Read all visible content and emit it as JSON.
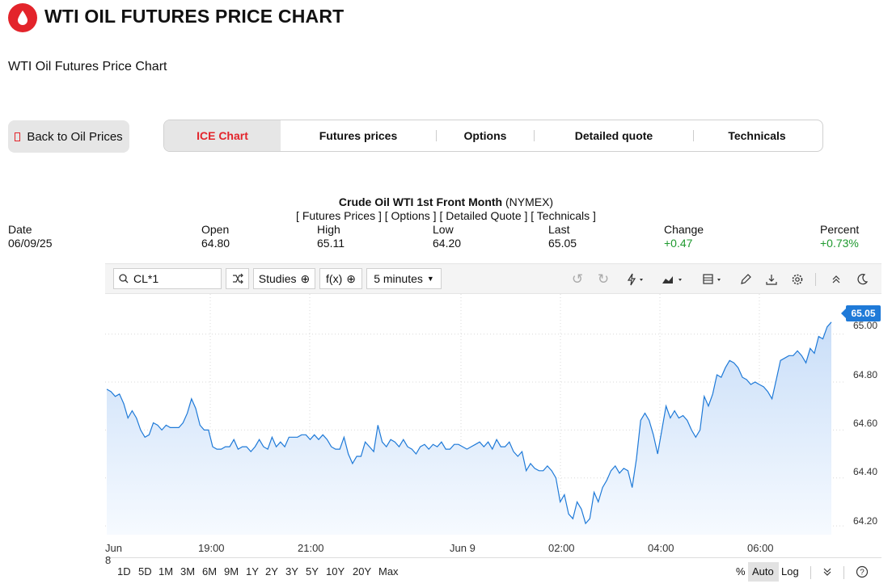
{
  "header": {
    "title": "WTI OIL FUTURES PRICE CHART",
    "subtitle": "WTI Oil Futures Price Chart",
    "logo_icon": "oil-drop-icon",
    "accent": "#e3242b"
  },
  "nav": {
    "back_label": "Back to Oil Prices",
    "tabs": [
      {
        "label": "ICE Chart",
        "active": true
      },
      {
        "label": "Futures prices"
      },
      {
        "label": "Options"
      },
      {
        "label": "Detailed quote"
      },
      {
        "label": "Technicals"
      }
    ]
  },
  "instrument": {
    "name": "Crude Oil WTI 1st Front Month",
    "exchange": "(NYMEX)",
    "links": "[ Futures Prices ] [ Options ] [ Detailed Quote ] [ Technicals ]"
  },
  "quote": {
    "date_label": "Date",
    "date": "06/09/25",
    "open_label": "Open",
    "open": "64.80",
    "high_label": "High",
    "high": "65.11",
    "low_label": "Low",
    "low": "64.20",
    "last_label": "Last",
    "last": "65.05",
    "change_label": "Change",
    "change": "+0.47",
    "percent_label": "Percent",
    "percent": "+0.73%"
  },
  "toolbar": {
    "symbol": "CL*1",
    "studies": "Studies",
    "fx": "f(x)",
    "interval": "5 minutes"
  },
  "footer": {
    "ranges": [
      "1D",
      "5D",
      "1M",
      "3M",
      "6M",
      "9M",
      "1Y",
      "2Y",
      "3Y",
      "5Y",
      "10Y",
      "20Y",
      "Max"
    ],
    "percent": "%",
    "auto": "Auto",
    "log": "Log"
  },
  "chart_data": {
    "type": "area",
    "x_tick_labels": [
      "Jun 8",
      "19:00",
      "21:00",
      "Jun 9",
      "02:00",
      "04:00",
      "06:00"
    ],
    "y_tick_labels": [
      "64.20",
      "64.40",
      "64.60",
      "64.80",
      "65.00"
    ],
    "ylim": [
      64.17,
      65.12
    ],
    "last_price_label": "65.05",
    "line_color": "#1f7ad8",
    "grid": true,
    "values": [
      64.77,
      64.76,
      64.74,
      64.75,
      64.71,
      64.65,
      64.68,
      64.65,
      64.6,
      64.57,
      64.58,
      64.63,
      64.62,
      64.6,
      64.62,
      64.61,
      64.61,
      64.61,
      64.63,
      64.67,
      64.73,
      64.69,
      64.62,
      64.6,
      64.6,
      64.53,
      64.52,
      64.52,
      64.53,
      64.53,
      64.56,
      64.52,
      64.53,
      64.53,
      64.51,
      64.53,
      64.56,
      64.53,
      64.52,
      64.57,
      64.53,
      64.55,
      64.53,
      64.57,
      64.57,
      64.57,
      64.58,
      64.58,
      64.56,
      64.58,
      64.56,
      64.58,
      64.56,
      64.53,
      64.52,
      64.52,
      64.57,
      64.5,
      64.46,
      64.49,
      64.49,
      64.55,
      64.53,
      64.51,
      64.62,
      64.55,
      64.53,
      64.56,
      64.55,
      64.53,
      64.56,
      64.53,
      64.52,
      64.5,
      64.53,
      64.54,
      64.52,
      64.54,
      64.53,
      64.55,
      64.52,
      64.52,
      64.54,
      64.54,
      64.53,
      64.52,
      64.53,
      64.54,
      64.55,
      64.53,
      64.55,
      64.52,
      64.56,
      64.53,
      64.53,
      64.55,
      64.51,
      64.49,
      64.51,
      64.43,
      64.46,
      64.44,
      64.43,
      64.43,
      64.45,
      64.43,
      64.4,
      64.3,
      64.33,
      64.25,
      64.23,
      64.3,
      64.27,
      64.21,
      64.23,
      64.34,
      64.3,
      64.36,
      64.39,
      64.43,
      64.45,
      64.42,
      64.44,
      64.43,
      64.36,
      64.48,
      64.64,
      64.67,
      64.64,
      64.58,
      64.5,
      64.6,
      64.7,
      64.65,
      64.68,
      64.65,
      64.66,
      64.64,
      64.6,
      64.57,
      64.6,
      64.74,
      64.7,
      64.75,
      64.83,
      64.82,
      64.86,
      64.89,
      64.88,
      64.86,
      64.82,
      64.81,
      64.79,
      64.8,
      64.79,
      64.78,
      64.76,
      64.73,
      64.81,
      64.89,
      64.9,
      64.91,
      64.91,
      64.93,
      64.91,
      64.88,
      64.94,
      64.92,
      64.99,
      64.98,
      65.03,
      65.05
    ]
  }
}
